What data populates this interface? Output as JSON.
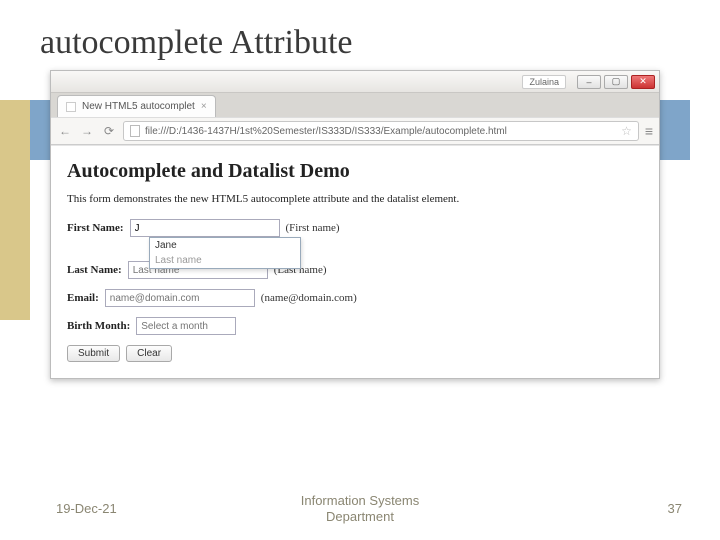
{
  "slide": {
    "title": "autocomplete Attribute",
    "footer_date": "19-Dec-21",
    "footer_dept_line1": "Information Systems",
    "footer_dept_line2": "Department",
    "page_number": "37"
  },
  "browser": {
    "user_badge": "Zulaina",
    "tab_title": "New HTML5 autocomplet",
    "url": "file:///D:/1436-1437H/1st%20Semester/IS333D/IS333/Example/autocomplete.html"
  },
  "demo": {
    "heading": "Autocomplete and Datalist Demo",
    "description": "This form demonstrates the new HTML5 autocomplete attribute and the datalist element.",
    "first_name": {
      "label": "First Name:",
      "value": "J",
      "suffix": "(First name)"
    },
    "ac_suggestion": "Jane",
    "ac_placeholder_row": "Last name",
    "last_name": {
      "label": "Last Name:",
      "placeholder": "Last name",
      "suffix": "(Last name)"
    },
    "email": {
      "label": "Email:",
      "placeholder": "name@domain.com",
      "suffix": "(name@domain.com)"
    },
    "birth_month": {
      "label": "Birth Month:",
      "placeholder": "Select a month"
    },
    "submit_label": "Submit",
    "clear_label": "Clear"
  }
}
